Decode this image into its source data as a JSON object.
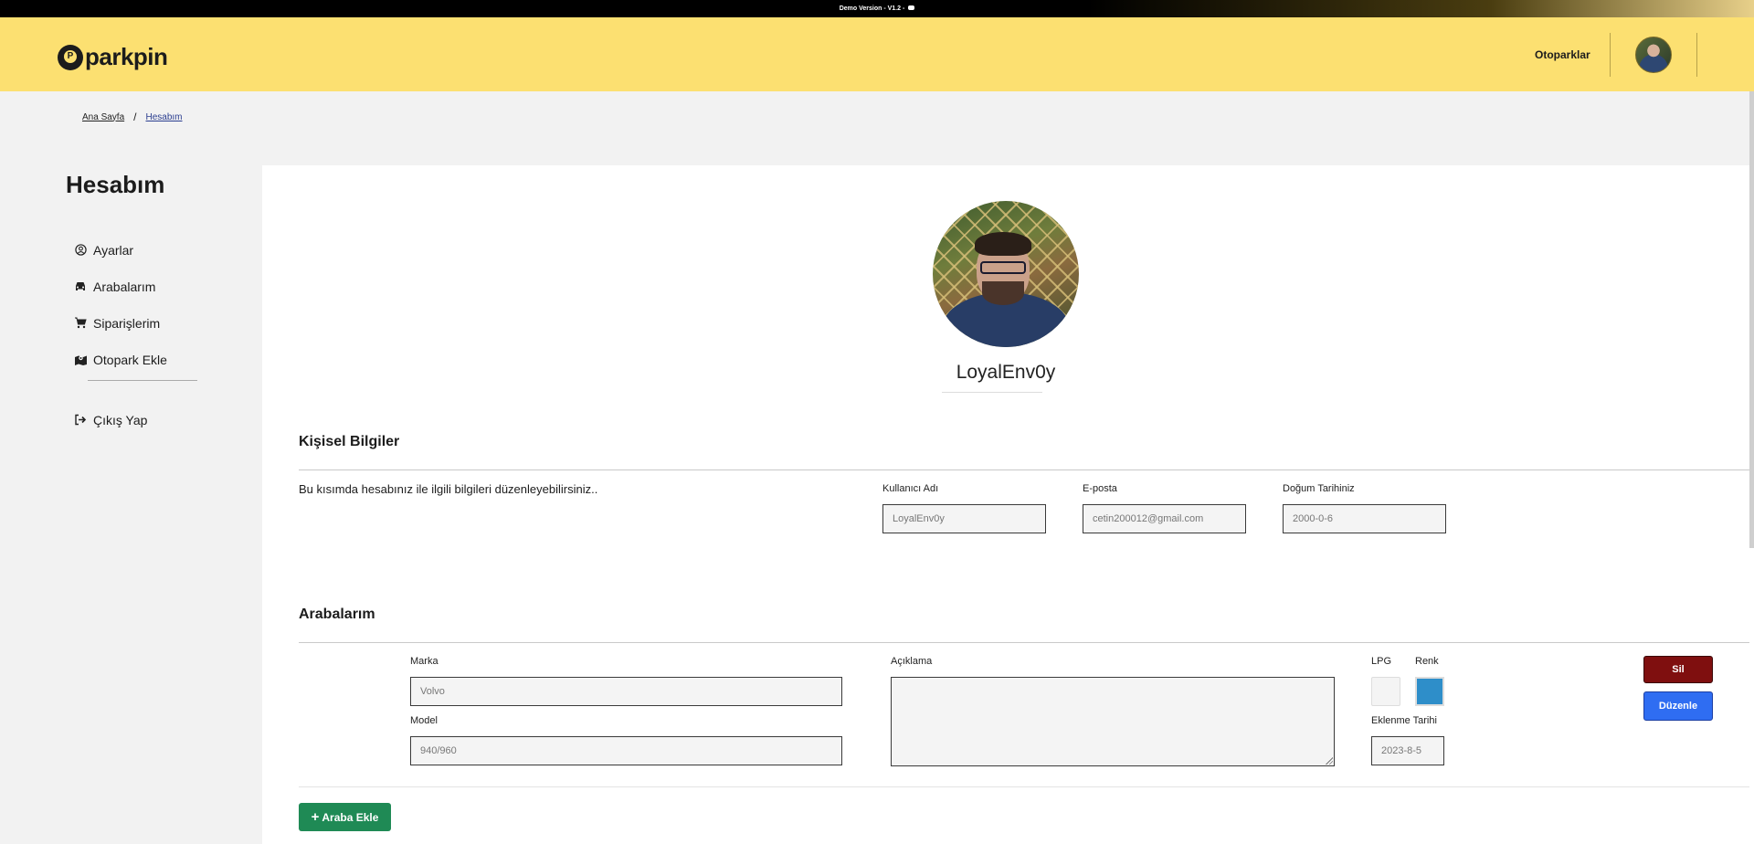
{
  "banner": {
    "text": "Demo Version - V1.2 -"
  },
  "navbar": {
    "brand": "parkpin",
    "logo_letter": "P",
    "link": "Otoparklar"
  },
  "breadcrumb": {
    "home": "Ana Sayfa",
    "separator": "/",
    "current": "Hesabım"
  },
  "sidebar": {
    "title": "Hesabım",
    "items": [
      {
        "label": "Ayarlar",
        "icon": "user-circle-icon"
      },
      {
        "label": "Arabalarım",
        "icon": "car-icon"
      },
      {
        "label": "Siparişlerim",
        "icon": "cart-icon"
      },
      {
        "label": "Otopark Ekle",
        "icon": "map-pin-icon"
      }
    ],
    "logout": "Çıkış Yap"
  },
  "profile": {
    "username": "LoyalEnv0y"
  },
  "personal": {
    "title": "Kişisel Bilgiler",
    "description": "Bu kısımda hesabınız ile ilgili bilgileri düzenleyebilirsiniz..",
    "username_label": "Kullanıcı Adı",
    "username_value": "LoyalEnv0y",
    "email_label": "E-posta",
    "email_value": "cetin200012@gmail.com",
    "birth_label": "Doğum Tarihiniz",
    "birth_value": "2000-0-6"
  },
  "cars": {
    "title": "Arabalarım",
    "brand_label": "Marka",
    "brand_value": "Volvo",
    "model_label": "Model",
    "model_value": "940/960",
    "desc_label": "Açıklama",
    "lpg_label": "LPG",
    "color_label": "Renk",
    "color_value": "#2e8ec9",
    "added_label": "Eklenme Tarihi",
    "added_value": "2023-8-5",
    "delete_label": "Sil",
    "edit_label": "Düzenle",
    "add_label": "Araba Ekle"
  }
}
